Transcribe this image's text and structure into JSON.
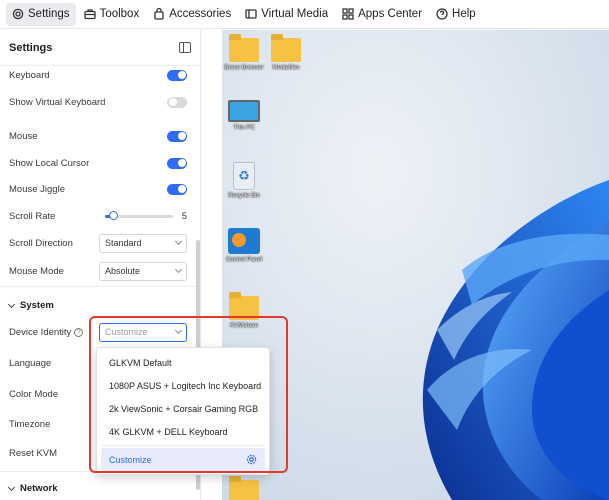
{
  "topbar": {
    "tabs": [
      {
        "label": "Settings",
        "icon": "gear-icon",
        "active": true
      },
      {
        "label": "Toolbox",
        "icon": "toolbox-icon"
      },
      {
        "label": "Accessories",
        "icon": "bag-icon"
      },
      {
        "label": "Virtual Media",
        "icon": "media-icon"
      },
      {
        "label": "Apps Center",
        "icon": "apps-grid-icon"
      },
      {
        "label": "Help",
        "icon": "help-circle-icon"
      }
    ]
  },
  "panel": {
    "title": "Settings",
    "rows": {
      "keyboard": {
        "label": "Keyboard",
        "on": true
      },
      "show_virtual_keyboard": {
        "label": "Show Virtual Keyboard",
        "on": false
      },
      "mouse": {
        "label": "Mouse",
        "on": true
      },
      "show_local_cursor": {
        "label": "Show Local Cursor",
        "on": true
      },
      "mouse_jiggle": {
        "label": "Mouse Jiggle",
        "on": true
      },
      "scroll_rate": {
        "label": "Scroll Rate",
        "value": "5",
        "level": 0.12
      },
      "scroll_direction": {
        "label": "Scroll Direction",
        "value": "Standard"
      },
      "mouse_mode": {
        "label": "Mouse Mode",
        "value": "Absolute"
      }
    },
    "system": {
      "title": "System",
      "device_identity": {
        "label": "Device Identity",
        "placeholder": "Customize"
      },
      "language": {
        "label": "Language"
      },
      "color_mode": {
        "label": "Color Mode"
      },
      "timezone": {
        "label": "Timezone"
      },
      "reset_kvm": {
        "label": "Reset KVM"
      }
    },
    "network": {
      "title": "Network"
    }
  },
  "dropdown": {
    "options": [
      "GLKVM Default",
      "1080P ASUS + Logitech Inc Keyboard",
      "2k ViewSonic + Corsair Gaming RGB",
      "4K GLKVM + DELL Keyboard"
    ],
    "customize_label": "Customize"
  },
  "desktop": {
    "icons": [
      {
        "label": "Brave Browser",
        "kind": "folder"
      },
      {
        "label": "Mediafiles",
        "kind": "folder"
      },
      {
        "label": "This PC",
        "kind": "monitor"
      },
      {
        "label": "Recycle Bin",
        "kind": "recycle-bin"
      },
      {
        "label": "Control Panel",
        "kind": "control-panel"
      },
      {
        "label": "KVMshare",
        "kind": "folder"
      }
    ]
  },
  "colors": {
    "accent": "#2f6cf6",
    "annotation": "#e03a2e",
    "wallpaper": "#1e6fe0"
  }
}
